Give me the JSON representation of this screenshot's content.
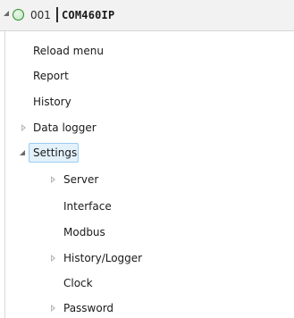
{
  "device": {
    "id": "001",
    "name": "COM460IP",
    "status_icon": "green-status-circle",
    "expanded": true
  },
  "tree": {
    "items": [
      {
        "label": "Reload menu",
        "has_children": false,
        "expanded": false,
        "depth": 1
      },
      {
        "label": "Report",
        "has_children": false,
        "expanded": false,
        "depth": 1
      },
      {
        "label": "History",
        "has_children": false,
        "expanded": false,
        "depth": 1
      },
      {
        "label": "Data logger",
        "has_children": true,
        "expanded": false,
        "depth": 1
      },
      {
        "label": "Settings",
        "has_children": true,
        "expanded": true,
        "selected": true,
        "depth": 1
      },
      {
        "label": "Server",
        "has_children": true,
        "expanded": false,
        "depth": 2
      },
      {
        "label": "Interface",
        "has_children": false,
        "expanded": false,
        "depth": 2
      },
      {
        "label": "Modbus",
        "has_children": false,
        "expanded": false,
        "depth": 2
      },
      {
        "label": "History/Logger",
        "has_children": true,
        "expanded": false,
        "depth": 2
      },
      {
        "label": "Clock",
        "has_children": false,
        "expanded": false,
        "depth": 2
      },
      {
        "label": "Password",
        "has_children": true,
        "expanded": false,
        "depth": 2
      }
    ]
  },
  "colors": {
    "header_bg": "#f2f2f2",
    "status_green": "#2e8b2e",
    "selection_bg": "#e3f1fb",
    "selection_border": "#9ccbef"
  }
}
